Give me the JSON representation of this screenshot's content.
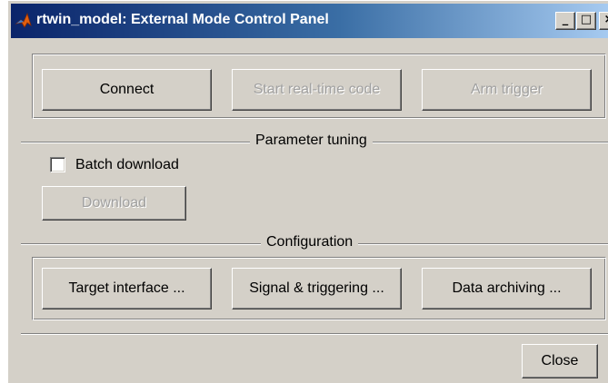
{
  "window": {
    "title": "rtwin_model: External Mode Control Panel",
    "title_buttons": {
      "minimize": "_",
      "maximize": "□",
      "close": "×"
    }
  },
  "top_buttons": {
    "connect": "Connect",
    "start_realtime": "Start real-time code",
    "arm_trigger": "Arm trigger"
  },
  "parameter_tuning": {
    "section_label": "Parameter tuning",
    "batch_download_label": "Batch download",
    "batch_download_checked": false,
    "download_button": "Download"
  },
  "configuration": {
    "section_label": "Configuration",
    "target_interface": "Target interface ...",
    "signal_triggering": "Signal & triggering ...",
    "data_archiving": "Data archiving ..."
  },
  "footer": {
    "close_button": "Close"
  },
  "colors": {
    "face": "#d4d0c8",
    "title_start": "#0a246a",
    "title_end": "#a6caf0",
    "disabled_text": "#a0a0a0"
  },
  "icons": {
    "app": "matlab-icon"
  }
}
